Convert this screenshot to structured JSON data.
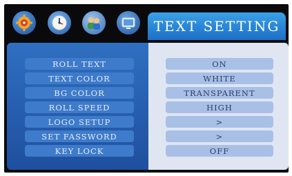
{
  "header": {
    "title": "TEXT SETTING"
  },
  "icons": [
    {
      "name": "settings-gear-icon",
      "selected": false
    },
    {
      "name": "clock-icon",
      "selected": false
    },
    {
      "name": "users-icon",
      "selected": true
    },
    {
      "name": "display-monitor-icon",
      "selected": false
    }
  ],
  "menu": {
    "items": [
      {
        "label": "ROLL TEXT",
        "value": "ON"
      },
      {
        "label": "TEXT COLOR",
        "value": "WHITE"
      },
      {
        "label": "BG COLOR",
        "value": "TRANSPARENT"
      },
      {
        "label": "ROLL SPEED",
        "value": "HIGH"
      },
      {
        "label": "LOGO SETUP",
        "value": ">"
      },
      {
        "label": "SET FASSWORD",
        "value": ">"
      },
      {
        "label": "KEY LOCK",
        "value": "OFF"
      }
    ]
  },
  "colors": {
    "title_bar": "#2b8be0",
    "left_pane": "#2a62b4",
    "right_pane": "#dfe6f2",
    "selection_underline": "#e0402a"
  }
}
